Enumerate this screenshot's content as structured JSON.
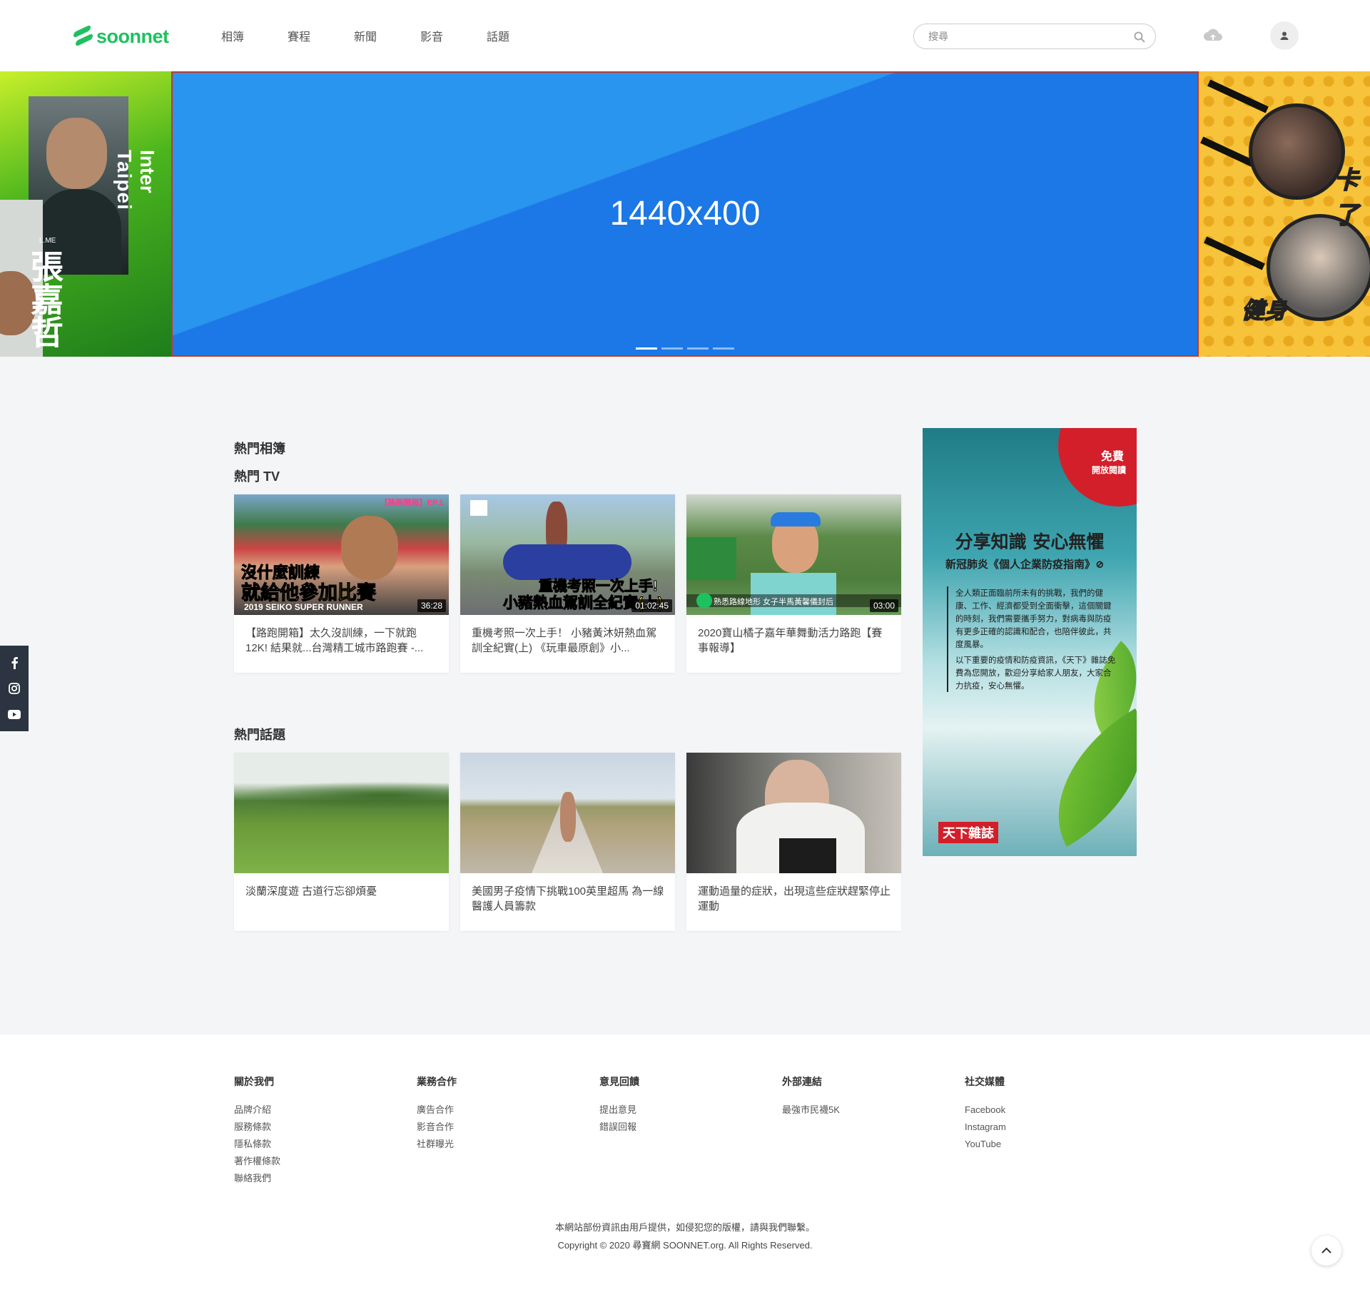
{
  "brand": {
    "name": "soonnet",
    "color": "#1ec15f"
  },
  "nav": {
    "items": [
      "相簿",
      "賽程",
      "新聞",
      "影音",
      "話題"
    ]
  },
  "search": {
    "placeholder": "搜尋"
  },
  "carousel": {
    "main_label": "1440x400",
    "dot_count": 4,
    "active_dot": 0,
    "left_slide": {
      "text_en_1": "Inter",
      "text_en_2": "Taipei",
      "text_zh": "張嘉哲",
      "text_small": "L.ME"
    },
    "right_slide": {
      "text_1": "卡了",
      "text_2": "健身"
    }
  },
  "social_side": {
    "icons": [
      "facebook-icon",
      "instagram-icon",
      "youtube-icon"
    ]
  },
  "sections": {
    "albums_title": "熱門相簿",
    "tv_title": "熱門 TV",
    "topics_title": "熱門話題"
  },
  "tv_cards": [
    {
      "title": "【路跑開箱】太久沒訓練，一下就跑12K! 結果就...台灣精工城市路跑賽 -...",
      "duration": "36:28",
      "caption_1": "沒什麼訓練",
      "caption_2": "就給他參加比賽",
      "caption_3": "2019 SEIKO SUPER RUNNER",
      "tag": "【路跑開箱】EP.1"
    },
    {
      "title": "重機考照一次上手！ 小豬黃沐妍熱血駕訓全紀實(上) 《玩車最原創》小...",
      "duration": "01:02:45",
      "caption_1": "重機考照一次上手!",
      "caption_2": "小豬熱血駕訓全紀實(上)"
    },
    {
      "title": "2020寶山橘子嘉年華舞動活力路跑【賽事報導】",
      "duration": "03:00",
      "caption_1": "熟悉路線地形 女子半馬黃馨儀封后"
    }
  ],
  "topic_cards": [
    {
      "title": "淡蘭深度遊 古道行忘卻煩憂"
    },
    {
      "title": "美國男子疫情下挑戰100英里超馬 為一線醫護人員籌款"
    },
    {
      "title": "運動過量的症狀，出現這些症狀趕緊停止運動"
    }
  ],
  "ad": {
    "corner_1": "免費",
    "corner_2": "開放閱讀",
    "headline": "分享知識 安心無懼",
    "subline": "新冠肺炎《個人企業防疫指南》⊘",
    "body_1": "全人類正面臨前所未有的挑戰，我們的健康、工作、經濟都受到全面衝擊，這個關鍵的時刻，我們需要攜手努力，對病毒與防疫有更多正確的認識和配合，也陪伴彼此，共度風暴。",
    "body_2": "以下重要的疫情和防疫資訊，《天下》雜誌免費為您開放，歡迎分享給家人朋友，大家合力抗疫，安心無懼。",
    "brand": "天下雜誌"
  },
  "footer": {
    "columns": [
      {
        "heading": "關於我們",
        "links": [
          "品牌介紹",
          "服務條款",
          "隱私條款",
          "著作權條款",
          "聯絡我們"
        ]
      },
      {
        "heading": "業務合作",
        "links": [
          "廣告合作",
          "影音合作",
          "社群曝光"
        ]
      },
      {
        "heading": "意見回饋",
        "links": [
          "提出意見",
          "錯誤回報"
        ]
      },
      {
        "heading": "外部連結",
        "links": [
          "最強市民襪5K"
        ]
      },
      {
        "heading": "社交媒體",
        "links": [
          "Facebook",
          "Instagram",
          "YouTube"
        ]
      }
    ],
    "notice": "本網站部份資訊由用戶提供，如侵犯您的版權，請與我們聯繫。",
    "copyright": "Copyright © 2020 尋寶網 SOONNET.org. All Rights Reserved."
  }
}
